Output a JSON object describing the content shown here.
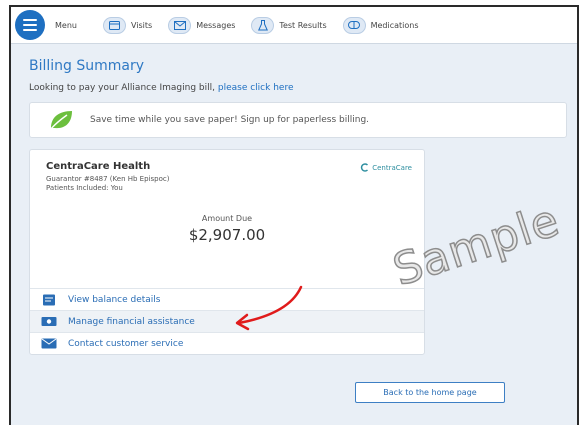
{
  "nav": {
    "menu_label": "Menu",
    "items": [
      {
        "label": "Visits",
        "icon": "calendar-icon"
      },
      {
        "label": "Messages",
        "icon": "envelope-icon"
      },
      {
        "label": "Test Results",
        "icon": "flask-icon"
      },
      {
        "label": "Medications",
        "icon": "pill-icon"
      }
    ]
  },
  "page": {
    "title": "Billing Summary",
    "pay_prompt": "Looking to pay your Alliance Imaging bill,",
    "pay_link": "please click here"
  },
  "paperless": {
    "text": "Save time while you save paper! Sign up for paperless billing."
  },
  "account": {
    "provider": "CentraCare Health",
    "guarantor": "Guarantor #8487 (Ken Hb Epispoc)",
    "patients": "Patients Included: You",
    "logo_text": "CentraCare",
    "amount_label": "Amount Due",
    "amount_value": "$2,907.00"
  },
  "links": [
    {
      "label": "View balance details",
      "icon": "document-icon"
    },
    {
      "label": "Manage financial assistance",
      "icon": "money-icon"
    },
    {
      "label": "Contact customer service",
      "icon": "mail-icon"
    }
  ],
  "watermark": "Sample",
  "home_button": "Back to the home page",
  "colors": {
    "accent": "#1e6fc1",
    "title": "#2f79c4",
    "annotation_arrow": "#e01b1b",
    "background": "#e9eff6"
  }
}
